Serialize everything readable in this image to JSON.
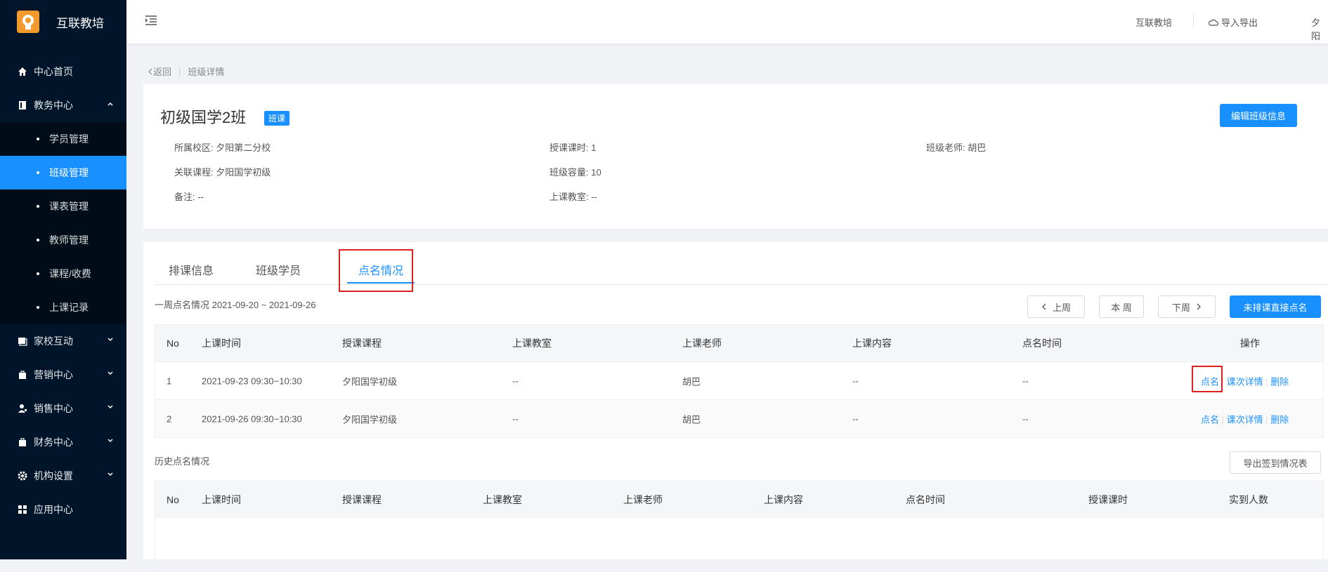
{
  "brand": {
    "title": "互联教培",
    "logo_text": "互联教培"
  },
  "colors": {
    "sidebar": "#001529",
    "accent": "#1890ff",
    "highlight": "#e02020"
  },
  "sidebar": {
    "items": [
      {
        "label": "中心首页",
        "icon": "home-icon"
      },
      {
        "label": "教务中心",
        "icon": "book-icon"
      },
      {
        "label": "家校互动",
        "icon": "chat-icon"
      },
      {
        "label": "营销中心",
        "icon": "bag-icon"
      },
      {
        "label": "销售中心",
        "icon": "user-icon"
      },
      {
        "label": "财务中心",
        "icon": "wallet-icon"
      },
      {
        "label": "机构设置",
        "icon": "gear-icon"
      },
      {
        "label": "应用中心",
        "icon": "grid-icon"
      }
    ],
    "sub_items": [
      "学员管理",
      "班级管理",
      "课表管理",
      "教师管理",
      "课程/收费",
      "上课记录"
    ]
  },
  "topbar": {
    "org": "互联教培",
    "import_export": "导入导出",
    "user": "夕阳"
  },
  "breadcrumb": {
    "back": "返回",
    "current": "班级详情"
  },
  "class_info": {
    "name": "初级国学2班",
    "tag": "班课",
    "edit_button": "编辑班级信息",
    "fields": {
      "campus": "所属校区: 夕阳第二分校",
      "course": "关联课程: 夕阳国学初级",
      "note": "备注: --",
      "hours": "授课课时: 1",
      "capacity": "班级容量: 10",
      "room": "上课教室: --",
      "teacher": "班级老师: 胡巴"
    }
  },
  "tabs": [
    "排课信息",
    "班级学员",
    "点名情况"
  ],
  "week": {
    "label": "一周点名情况 2021-09-20 ~ 2021-09-26",
    "prev": "上周",
    "current": "本 周",
    "next": "下周",
    "direct": "未排课直接点名"
  },
  "week_table": {
    "headers": [
      "No",
      "上课时间",
      "授课课程",
      "上课教室",
      "上课老师",
      "上课内容",
      "点名时间",
      "操作"
    ],
    "rows": [
      {
        "no": "1",
        "time": "2021-09-23 09:30~10:30",
        "course": "夕阳国学初级",
        "room": "--",
        "teacher": "胡巴",
        "content": "--",
        "rollcall": "--"
      },
      {
        "no": "2",
        "time": "2021-09-26 09:30~10:30",
        "course": "夕阳国学初级",
        "room": "--",
        "teacher": "胡巴",
        "content": "--",
        "rollcall": "--"
      }
    ],
    "actions": {
      "rollcall": "点名",
      "detail": "课次详情",
      "delete": "删除"
    }
  },
  "history": {
    "label": "历史点名情况",
    "export": "导出签到情况表",
    "headers": [
      "No",
      "上课时间",
      "授课课程",
      "上课教室",
      "上课老师",
      "上课内容",
      "点名时间",
      "授课课时",
      "实到人数"
    ]
  }
}
